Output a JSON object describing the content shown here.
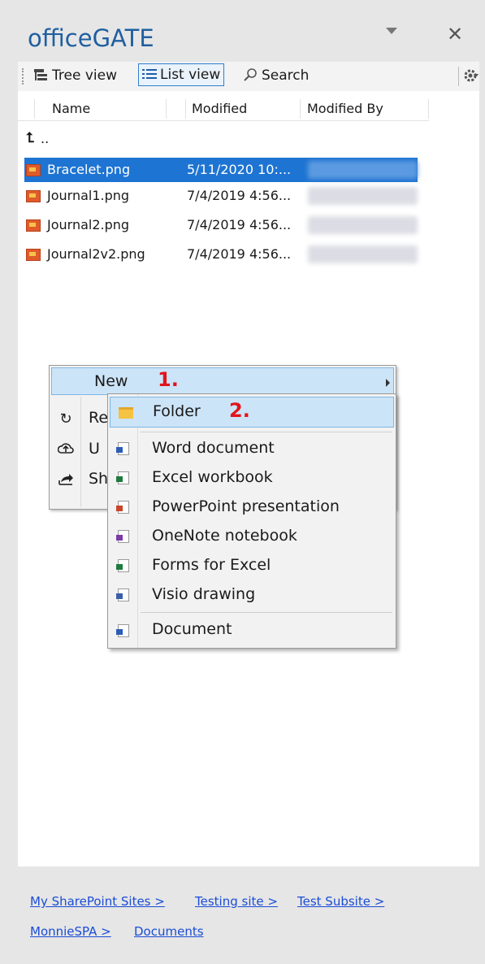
{
  "app": {
    "title": "officeGATE"
  },
  "toolbar": {
    "tree_view": "Tree view",
    "list_view": "List view",
    "search": "Search"
  },
  "columns": {
    "name": "Name",
    "modified": "Modified",
    "modified_by": "Modified By"
  },
  "parent_link": "..",
  "files": [
    {
      "name": "Bracelet.png",
      "modified": "5/11/2020 10:..."
    },
    {
      "name": "Journal1.png",
      "modified": "7/4/2019 4:56..."
    },
    {
      "name": "Journal2.png",
      "modified": "7/4/2019 4:56..."
    },
    {
      "name": "Journal2v2.png",
      "modified": "7/4/2019 4:56..."
    }
  ],
  "context_menu": {
    "new": "New",
    "new_annotation": "1.",
    "refresh_partial": "Re",
    "upload_partial": "U",
    "share_partial": "Sh"
  },
  "submenu": {
    "folder": "Folder",
    "folder_annotation": "2.",
    "items": [
      "Word document",
      "Excel workbook",
      "PowerPoint presentation",
      "OneNote notebook",
      "Forms for Excel",
      "Visio drawing"
    ],
    "document": "Document"
  },
  "breadcrumb": [
    "My SharePoint Sites >",
    "Testing site >",
    "Test Subsite >",
    "MonnieSPA >",
    "Documents"
  ],
  "colors": {
    "accent": "#1e74d2",
    "title": "#1f5fa0",
    "annotation": "#e0151b",
    "link": "#1a4dd6"
  }
}
